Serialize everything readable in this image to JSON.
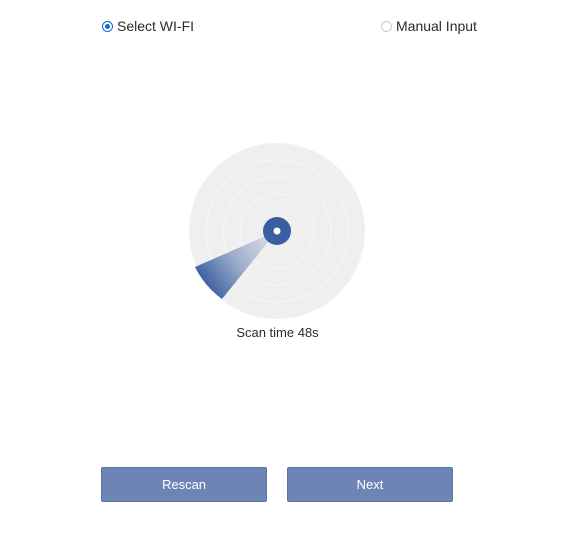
{
  "network_mode": {
    "options": [
      {
        "label": "Select WI-FI",
        "selected": true
      },
      {
        "label": "Manual Input",
        "selected": false
      }
    ]
  },
  "scan": {
    "status_text": "Scan time 48s"
  },
  "actions": {
    "rescan_label": "Rescan",
    "next_label": "Next"
  },
  "colors": {
    "accent": "#0b6ed1",
    "radar_blue": "#3a5fa0",
    "radar_bg": "#efefef",
    "button_bg": "#6d85b5"
  }
}
